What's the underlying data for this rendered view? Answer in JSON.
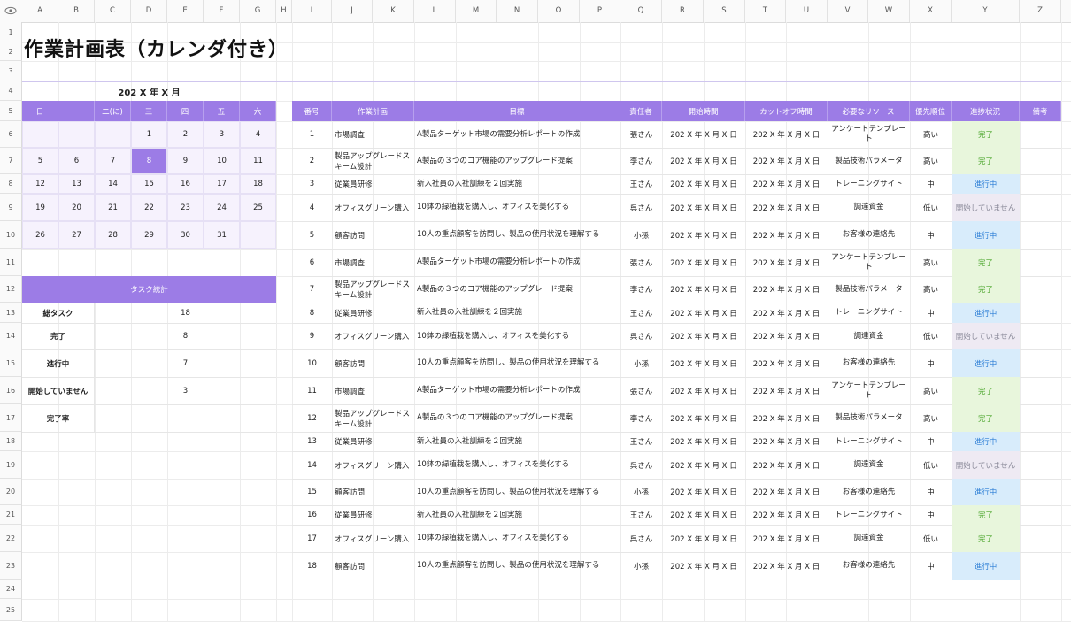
{
  "columns": [
    "A",
    "B",
    "C",
    "D",
    "E",
    "F",
    "G",
    "H",
    "I",
    "J",
    "K",
    "L",
    "M",
    "N",
    "O",
    "P",
    "Q",
    "R",
    "S",
    "T",
    "U",
    "V",
    "W",
    "X",
    "Y",
    "Z"
  ],
  "rows": [
    "1",
    "2",
    "3",
    "4",
    "5",
    "6",
    "7",
    "8",
    "9",
    "10",
    "11",
    "12",
    "13",
    "14",
    "15",
    "16",
    "17",
    "18",
    "19",
    "20",
    "21",
    "22",
    "23",
    "24",
    "25"
  ],
  "title": "作業計画表（カレンダ付き）",
  "calendar": {
    "month_label": "202 X 年 X 月",
    "weekdays": [
      "日",
      "一",
      "二(に)",
      "三",
      "四",
      "五",
      "六"
    ],
    "weeks": [
      [
        "",
        "",
        "",
        "1",
        "2",
        "3",
        "4"
      ],
      [
        "5",
        "6",
        "7",
        "8",
        "9",
        "10",
        "11"
      ],
      [
        "12",
        "13",
        "14",
        "15",
        "16",
        "17",
        "18"
      ],
      [
        "19",
        "20",
        "21",
        "22",
        "23",
        "24",
        "25"
      ],
      [
        "26",
        "27",
        "28",
        "29",
        "30",
        "31",
        ""
      ]
    ],
    "highlight": "8"
  },
  "stats": {
    "header": "タスク統計",
    "items": [
      {
        "label": "総タスク",
        "value": "18"
      },
      {
        "label": "完了",
        "value": "8"
      },
      {
        "label": "進行中",
        "value": "7"
      },
      {
        "label": "開始していません",
        "value": "3"
      },
      {
        "label": "完了率",
        "value": ""
      }
    ]
  },
  "table": {
    "headers": [
      "番号",
      "作業計画",
      "目標",
      "責任者",
      "開始時間",
      "カットオフ時間",
      "必要なリソース",
      "優先順位",
      "進捗状況",
      "備考"
    ],
    "rows": [
      {
        "no": "1",
        "plan": "市場調査",
        "goal": "A製品ターゲット市場の需要分析レポートの作成",
        "owner": "張さん",
        "start": "202 X 年 X 月 X 日",
        "end": "202 X 年 X 月 X 日",
        "res": "アンケートテンプレート",
        "pri": "高い",
        "status": "完了"
      },
      {
        "no": "2",
        "plan": "製品アップグレードスキーム設計",
        "goal": "A製品の３つのコア機能のアップグレード提案",
        "owner": "李さん",
        "start": "202 X 年 X 月 X 日",
        "end": "202 X 年 X 月 X 日",
        "res": "製品技術パラメータ",
        "pri": "高い",
        "status": "完了"
      },
      {
        "no": "3",
        "plan": "従業員研修",
        "goal": "新入社員の入社訓練を２回実施",
        "owner": "王さん",
        "start": "202 X 年 X 月 X 日",
        "end": "202 X 年 X 月 X 日",
        "res": "トレーニングサイト",
        "pri": "中",
        "status": "進行中"
      },
      {
        "no": "4",
        "plan": "オフィスグリーン購入",
        "goal": "10鉢の緑植栽を購入し、オフィスを美化する",
        "owner": "呉さん",
        "start": "202 X 年 X 月 X 日",
        "end": "202 X 年 X 月 X 日",
        "res": "調達資金",
        "pri": "低い",
        "status": "開始していません"
      },
      {
        "no": "5",
        "plan": "顧客訪問",
        "goal": "10人の重点顧客を訪問し、製品の使用状況を理解する",
        "owner": "小孫",
        "start": "202 X 年 X 月 X 日",
        "end": "202 X 年 X 月 X 日",
        "res": "お客様の連絡先",
        "pri": "中",
        "status": "進行中"
      },
      {
        "no": "6",
        "plan": "市場調査",
        "goal": "A製品ターゲット市場の需要分析レポートの作成",
        "owner": "張さん",
        "start": "202 X 年 X 月 X 日",
        "end": "202 X 年 X 月 X 日",
        "res": "アンケートテンプレート",
        "pri": "高い",
        "status": "完了"
      },
      {
        "no": "7",
        "plan": "製品アップグレードスキーム設計",
        "goal": "A製品の３つのコア機能のアップグレード提案",
        "owner": "李さん",
        "start": "202 X 年 X 月 X 日",
        "end": "202 X 年 X 月 X 日",
        "res": "製品技術パラメータ",
        "pri": "高い",
        "status": "完了"
      },
      {
        "no": "8",
        "plan": "従業員研修",
        "goal": "新入社員の入社訓練を２回実施",
        "owner": "王さん",
        "start": "202 X 年 X 月 X 日",
        "end": "202 X 年 X 月 X 日",
        "res": "トレーニングサイト",
        "pri": "中",
        "status": "進行中"
      },
      {
        "no": "9",
        "plan": "オフィスグリーン購入",
        "goal": "10鉢の緑植栽を購入し、オフィスを美化する",
        "owner": "呉さん",
        "start": "202 X 年 X 月 X 日",
        "end": "202 X 年 X 月 X 日",
        "res": "調達資金",
        "pri": "低い",
        "status": "開始していません"
      },
      {
        "no": "10",
        "plan": "顧客訪問",
        "goal": "10人の重点顧客を訪問し、製品の使用状況を理解する",
        "owner": "小孫",
        "start": "202 X 年 X 月 X 日",
        "end": "202 X 年 X 月 X 日",
        "res": "お客様の連絡先",
        "pri": "中",
        "status": "進行中"
      },
      {
        "no": "11",
        "plan": "市場調査",
        "goal": "A製品ターゲット市場の需要分析レポートの作成",
        "owner": "張さん",
        "start": "202 X 年 X 月 X 日",
        "end": "202 X 年 X 月 X 日",
        "res": "アンケートテンプレート",
        "pri": "高い",
        "status": "完了"
      },
      {
        "no": "12",
        "plan": "製品アップグレードスキーム設計",
        "goal": "A製品の３つのコア機能のアップグレード提案",
        "owner": "李さん",
        "start": "202 X 年 X 月 X 日",
        "end": "202 X 年 X 月 X 日",
        "res": "製品技術パラメータ",
        "pri": "高い",
        "status": "完了"
      },
      {
        "no": "13",
        "plan": "従業員研修",
        "goal": "新入社員の入社訓練を２回実施",
        "owner": "王さん",
        "start": "202 X 年 X 月 X 日",
        "end": "202 X 年 X 月 X 日",
        "res": "トレーニングサイト",
        "pri": "中",
        "status": "進行中"
      },
      {
        "no": "14",
        "plan": "オフィスグリーン購入",
        "goal": "10鉢の緑植栽を購入し、オフィスを美化する",
        "owner": "呉さん",
        "start": "202 X 年 X 月 X 日",
        "end": "202 X 年 X 月 X 日",
        "res": "調達資金",
        "pri": "低い",
        "status": "開始していません"
      },
      {
        "no": "15",
        "plan": "顧客訪問",
        "goal": "10人の重点顧客を訪問し、製品の使用状況を理解する",
        "owner": "小孫",
        "start": "202 X 年 X 月 X 日",
        "end": "202 X 年 X 月 X 日",
        "res": "お客様の連絡先",
        "pri": "中",
        "status": "進行中"
      },
      {
        "no": "16",
        "plan": "従業員研修",
        "goal": "新入社員の入社訓練を２回実施",
        "owner": "王さん",
        "start": "202 X 年 X 月 X 日",
        "end": "202 X 年 X 月 X 日",
        "res": "トレーニングサイト",
        "pri": "中",
        "status": "完了"
      },
      {
        "no": "17",
        "plan": "オフィスグリーン購入",
        "goal": "10鉢の緑植栽を購入し、オフィスを美化する",
        "owner": "呉さん",
        "start": "202 X 年 X 月 X 日",
        "end": "202 X 年 X 月 X 日",
        "res": "調達資金",
        "pri": "低い",
        "status": "完了"
      },
      {
        "no": "18",
        "plan": "顧客訪問",
        "goal": "10人の重点顧客を訪問し、製品の使用状況を理解する",
        "owner": "小孫",
        "start": "202 X 年 X 月 X 日",
        "end": "202 X 年 X 月 X 日",
        "res": "お客様の連絡先",
        "pri": "中",
        "status": "進行中"
      }
    ]
  },
  "colors": {
    "accent": "#9c7ce6",
    "done_bg": "#e8f6dc",
    "done_fg": "#4aa52b",
    "prog_bg": "#d8ecfb",
    "prog_fg": "#2e7fd6",
    "not_bg": "#eeeaf3",
    "not_fg": "#8a8a99"
  },
  "icons": {
    "corner": "eye-icon"
  }
}
